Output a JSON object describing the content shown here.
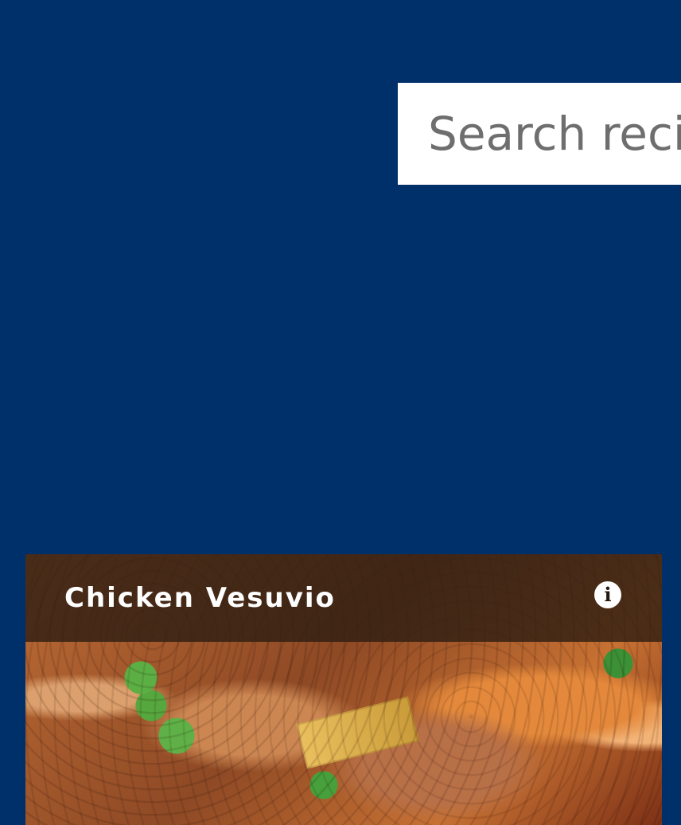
{
  "search": {
    "placeholder": "Search recipes"
  },
  "recipe_card": {
    "title": "Chicken Vesuvio",
    "info_icon": "info-icon",
    "image_description": "Chicken Vesuvio dish image"
  },
  "colors": {
    "background": "#00306a",
    "search_bg": "#ffffff",
    "placeholder": "#6e6e6e",
    "card_header_overlay": "#301e12",
    "card_title": "#ffffff"
  }
}
